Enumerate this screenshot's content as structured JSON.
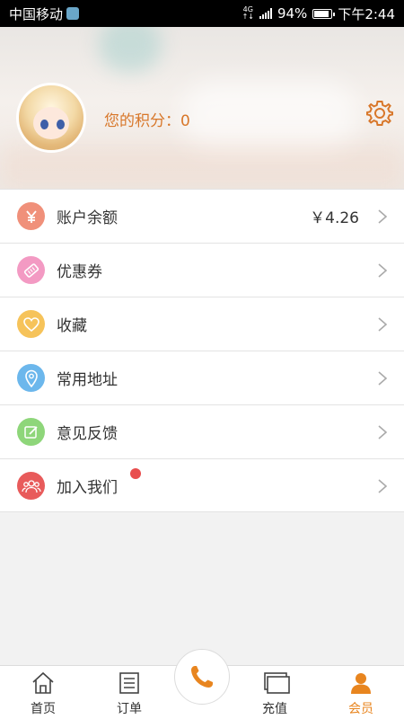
{
  "status_bar": {
    "carrier": "中国移动",
    "network": "4G",
    "battery": "94%",
    "time": "下午2:44"
  },
  "profile": {
    "points_label": "您的积分：",
    "points_value": "0"
  },
  "menu": {
    "items": [
      {
        "label": "账户余额",
        "value": "￥4.26",
        "icon": "yen-icon",
        "color": "#f0907a"
      },
      {
        "label": "优惠券",
        "value": "",
        "icon": "coupon-icon",
        "color": "#f39ac3"
      },
      {
        "label": "收藏",
        "value": "",
        "icon": "heart-icon",
        "color": "#f6c35a"
      },
      {
        "label": "常用地址",
        "value": "",
        "icon": "location-pin-icon",
        "color": "#6cb7ec"
      },
      {
        "label": "意见反馈",
        "value": "",
        "icon": "edit-icon",
        "color": "#8ed67a"
      },
      {
        "label": "加入我们",
        "value": "",
        "icon": "group-icon",
        "color": "#e85b5b",
        "badge": true
      }
    ]
  },
  "tab_bar": {
    "home": "首页",
    "orders": "订单",
    "call": "phone-icon",
    "recharge": "充值",
    "member": "会员",
    "accent_color": "#e8851f"
  }
}
